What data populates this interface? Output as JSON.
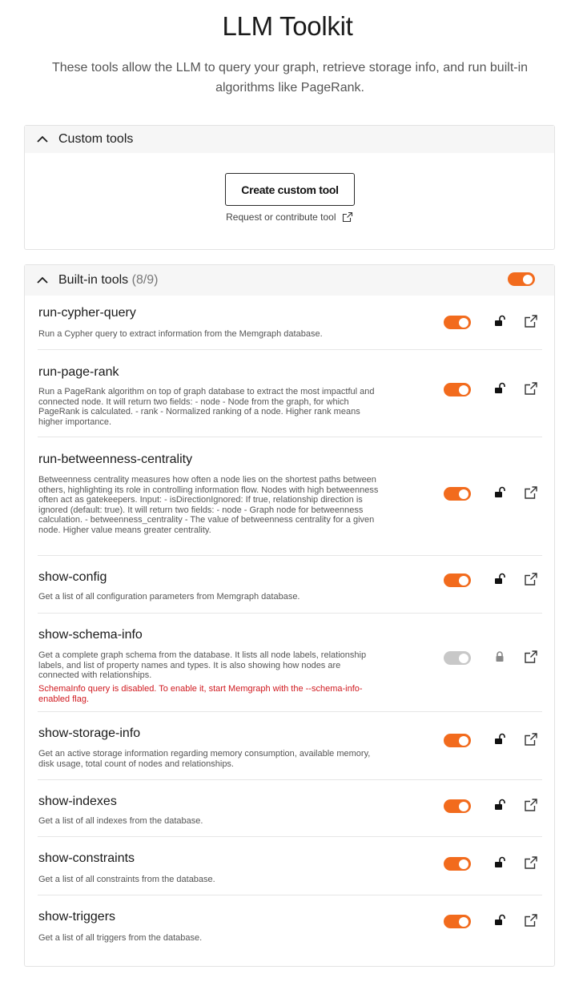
{
  "header": {
    "title": "LLM Toolkit",
    "subtitle": "These tools allow the LLM to query your graph, retrieve storage info, and run built-in algorithms like PageRank."
  },
  "custom_tools": {
    "title": "Custom tools",
    "create_button": "Create custom tool",
    "request_link": "Request or contribute tool"
  },
  "builtin_tools": {
    "title": "Built-in tools",
    "count": "(8/9)",
    "all_enabled": true,
    "tools": [
      {
        "name": "run-cypher-query",
        "description": "Run a Cypher query to extract information from the Memgraph database.",
        "enabled": true,
        "locked": false,
        "warning": ""
      },
      {
        "name": "run-page-rank",
        "description": "Run a PageRank algorithm on top of graph database to extract the most impactful and connected node. It will return two fields: - node - Node from the graph, for which PageRank is calculated. - rank - Normalized ranking of a node. Higher rank means higher importance.",
        "enabled": true,
        "locked": false,
        "warning": ""
      },
      {
        "name": "run-betweenness-centrality",
        "description": "Betweenness centrality measures how often a node lies on the shortest paths between others, highlighting its role in controlling information flow. Nodes with high betweenness often act as gatekeepers. Input: - isDirectionIgnored: If true, relationship direction is ignored (default: true). It will return two fields: - node - Graph node for betweenness calculation. - betweenness_centrality - The value of betweenness centrality for a given node. Higher value means greater centrality.",
        "enabled": true,
        "locked": false,
        "warning": ""
      },
      {
        "name": "show-config",
        "description": "Get a list of all configuration parameters from Memgraph database.",
        "enabled": true,
        "locked": false,
        "warning": ""
      },
      {
        "name": "show-schema-info",
        "description": "Get a complete graph schema from the database. It lists all node labels, relationship labels, and list of property names and types. It is also showing how nodes are connected with relationships.",
        "enabled": false,
        "locked": true,
        "warning": "SchemaInfo query is disabled. To enable it, start Memgraph with the --schema-info-enabled flag."
      },
      {
        "name": "show-storage-info",
        "description": "Get an active storage information regarding memory consumption, available memory, disk usage, total count of nodes and relationships.",
        "enabled": true,
        "locked": false,
        "warning": ""
      },
      {
        "name": "show-indexes",
        "description": "Get a list of all indexes from the database.",
        "enabled": true,
        "locked": false,
        "warning": ""
      },
      {
        "name": "show-constraints",
        "description": "Get a list of all constraints from the database.",
        "enabled": true,
        "locked": false,
        "warning": ""
      },
      {
        "name": "show-triggers",
        "description": "Get a list of all triggers from the database.",
        "enabled": true,
        "locked": false,
        "warning": ""
      }
    ]
  },
  "colors": {
    "accent": "#f26b1d",
    "toggle_off": "#c8c8c8",
    "warning": "#d0191f"
  },
  "icons": {
    "collapse": "chevron-up-icon",
    "lock_open": "unlocked-icon",
    "lock_closed": "lock-icon",
    "open": "external-link-icon"
  }
}
